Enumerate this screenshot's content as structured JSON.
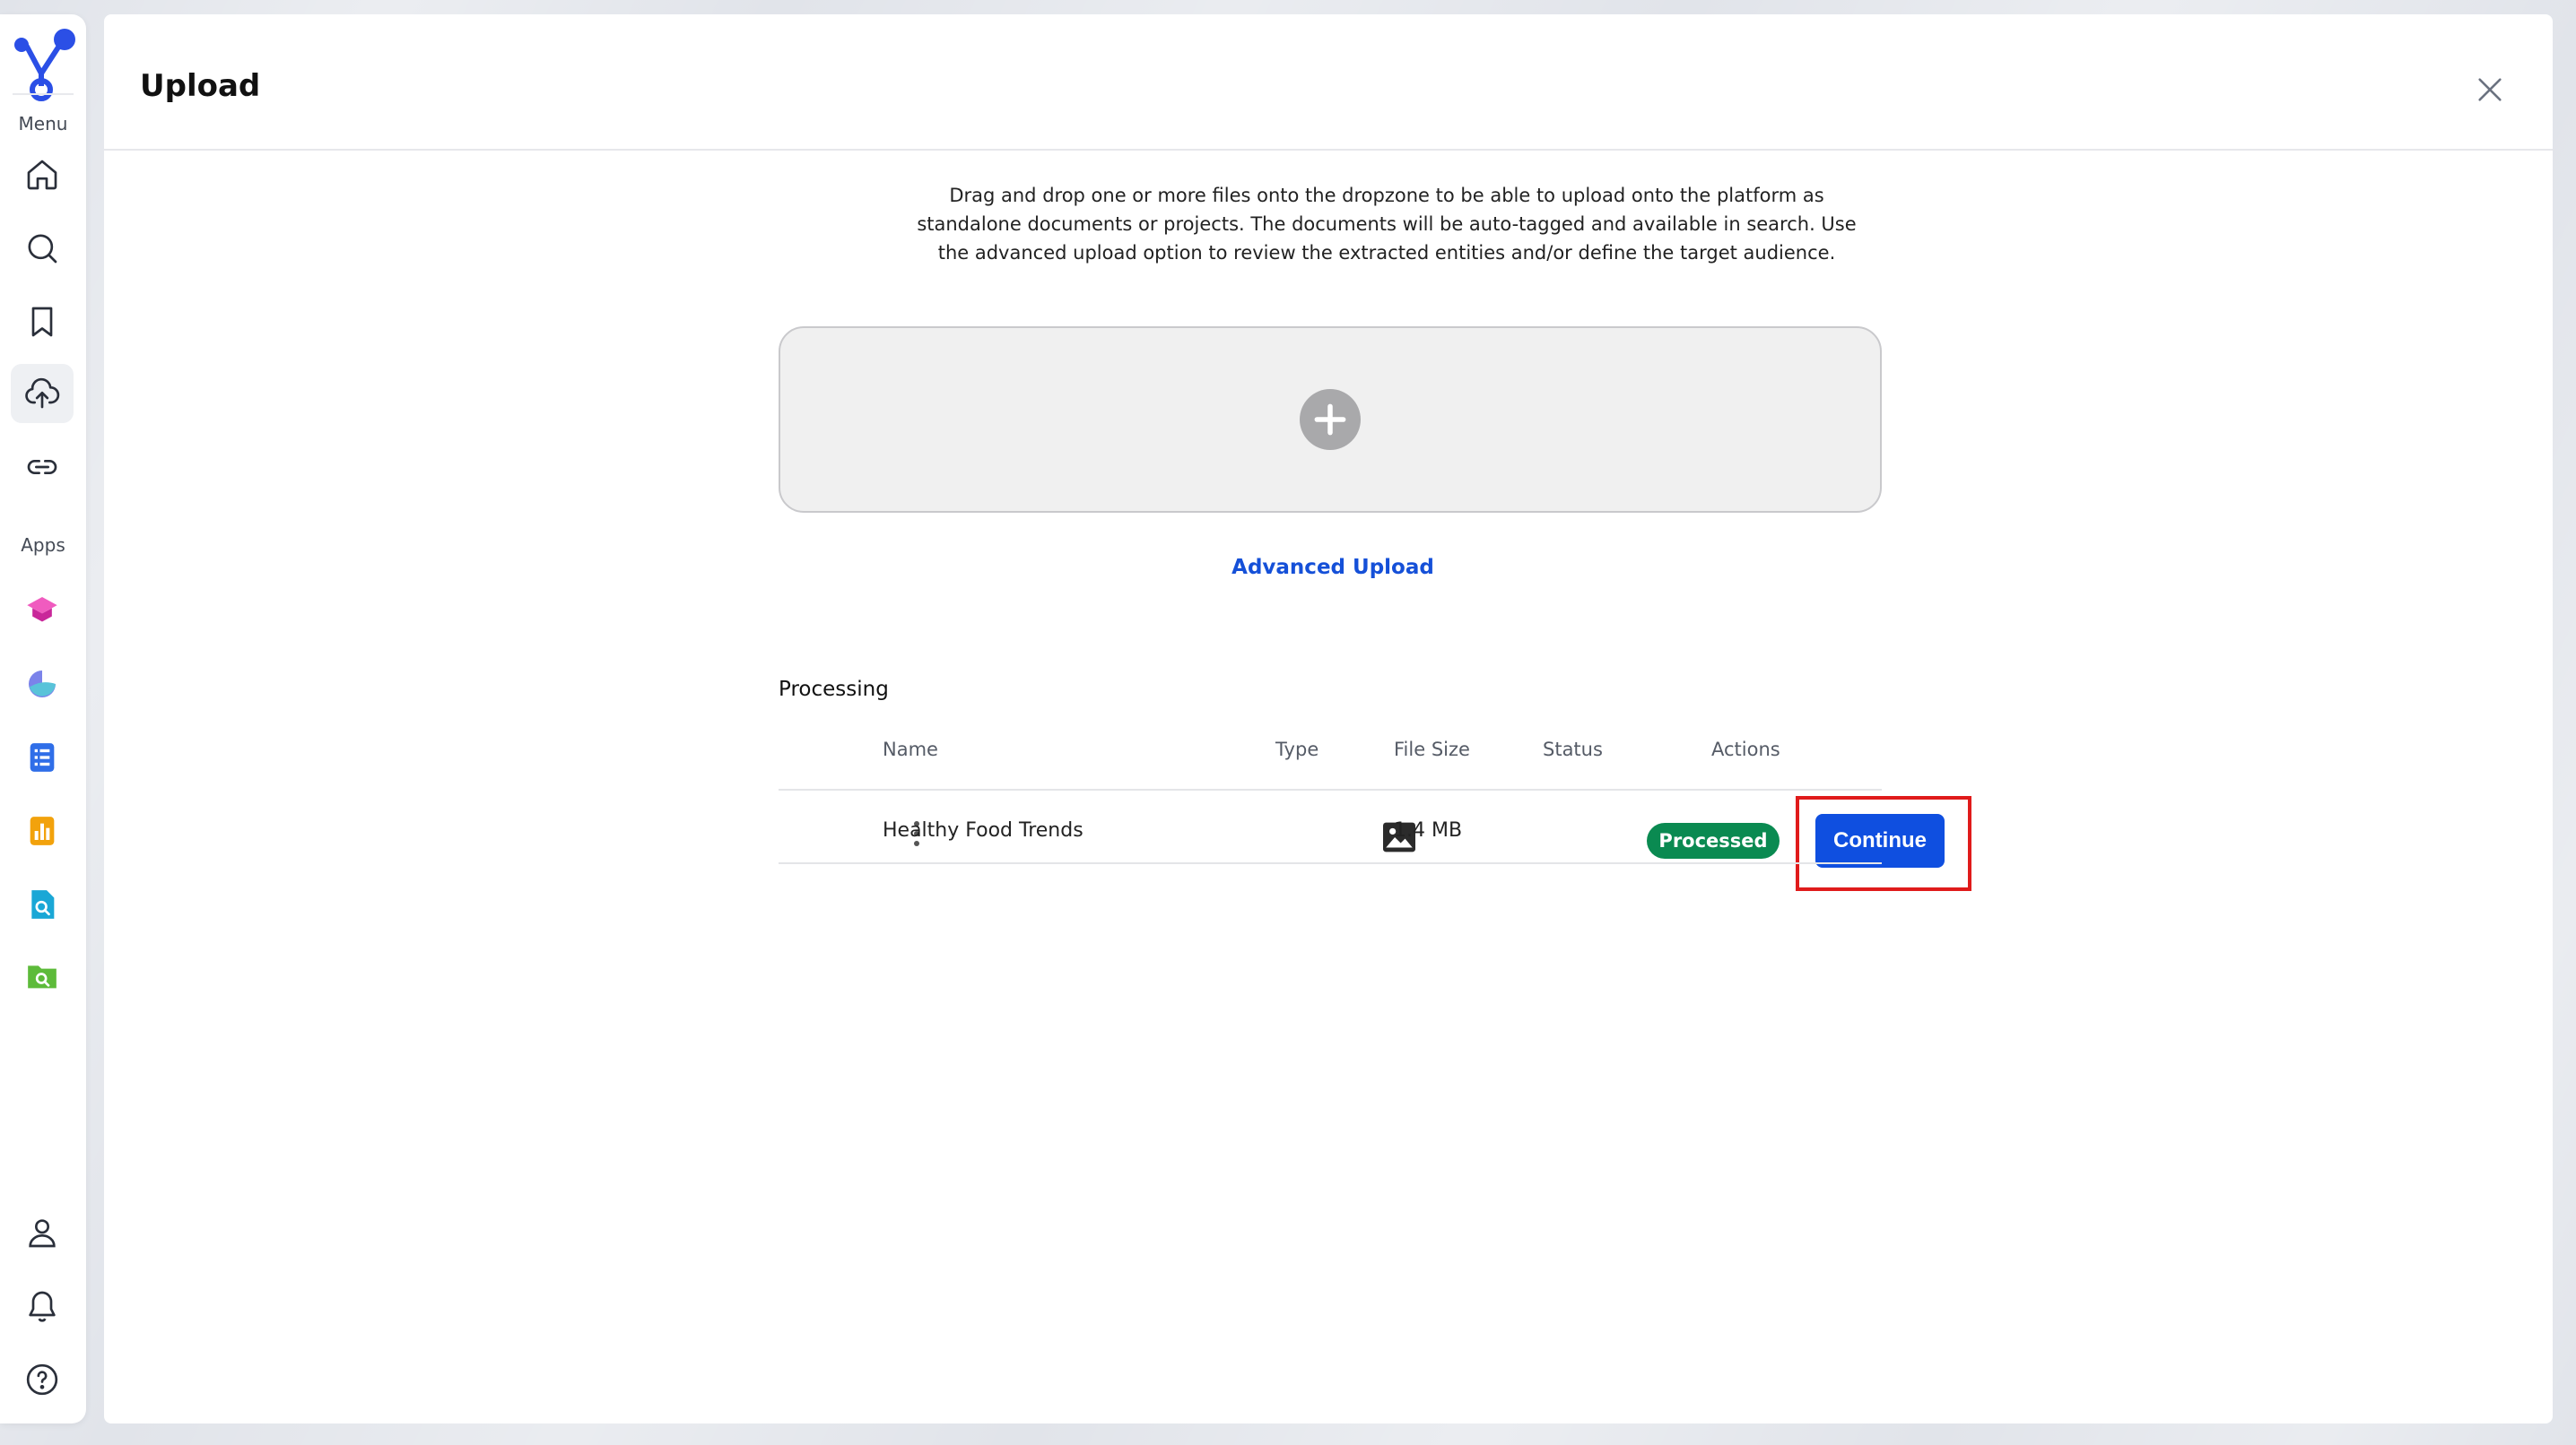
{
  "sidebar": {
    "menu_label": "Menu",
    "apps_label": "Apps",
    "nav_items": [
      {
        "icon": "home-icon"
      },
      {
        "icon": "search-icon"
      },
      {
        "icon": "bookmark-icon"
      },
      {
        "icon": "upload-cloud-icon",
        "active": true
      },
      {
        "icon": "link-icon"
      }
    ],
    "apps": [
      {
        "icon": "graduation-cap-icon",
        "color": "#e535a9"
      },
      {
        "icon": "pie-app-icon",
        "color": "#6c7be6"
      },
      {
        "icon": "document-list-icon",
        "color": "#2f6ee8"
      },
      {
        "icon": "bar-chart-icon",
        "color": "#f2a20c"
      },
      {
        "icon": "file-search-icon",
        "color": "#1aa7d6"
      },
      {
        "icon": "folder-search-icon",
        "color": "#5dbb3a"
      }
    ],
    "bottom_items": [
      {
        "icon": "user-icon"
      },
      {
        "icon": "bell-icon"
      },
      {
        "icon": "help-icon"
      }
    ]
  },
  "modal": {
    "title": "Upload",
    "instructions": "Drag and drop one or more files onto the dropzone to be able to upload onto the platform as standalone documents or projects. The documents will be auto-tagged and available in search. Use the advanced upload option to review the extracted entities and/or define the target audience.",
    "advanced_upload_label": "Advanced Upload",
    "processing": {
      "title": "Processing",
      "columns": [
        "Name",
        "Type",
        "File Size",
        "Status",
        "Actions"
      ],
      "rows": [
        {
          "name": "Healthy Food Trends",
          "type_icon": "image-icon",
          "file_size": "1.4 MB",
          "status": "Processed",
          "action_label": "Continue"
        }
      ]
    }
  },
  "colors": {
    "accent": "#0f4fe0",
    "link": "#1550d8",
    "status_processed": "#0a8a51",
    "highlight": "#e01b1b"
  }
}
